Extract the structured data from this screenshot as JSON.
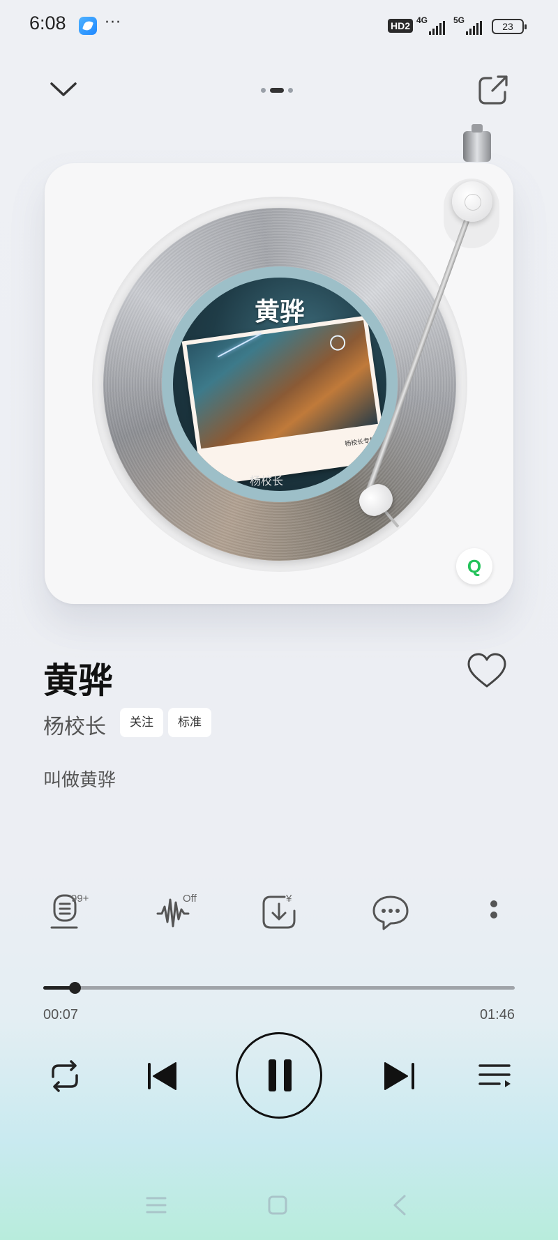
{
  "status_bar": {
    "time": "6:08",
    "more": "···",
    "hd": "HD2",
    "net1": "4G",
    "net2": "5G",
    "battery": "23"
  },
  "player": {
    "page_indicator": {
      "count": 3,
      "active": 1
    },
    "album_label_title": "黄骅",
    "album_label_caption": "杨校长专辑",
    "album_label_artist": "杨校长",
    "source_badge": "Q"
  },
  "song": {
    "title": "黄骅",
    "artist": "杨校长",
    "follow_label": "关注",
    "quality_label": "标准",
    "lyric": "叫做黄骅"
  },
  "actions": {
    "comments_count": "99+",
    "effect_state": "Off",
    "download_sup": "¥"
  },
  "progress": {
    "current": "00:07",
    "total": "01:46",
    "fraction": 0.067
  },
  "colors": {
    "accent": "#111111",
    "qq_green": "#23c25a",
    "track": "#9fa3a8"
  }
}
